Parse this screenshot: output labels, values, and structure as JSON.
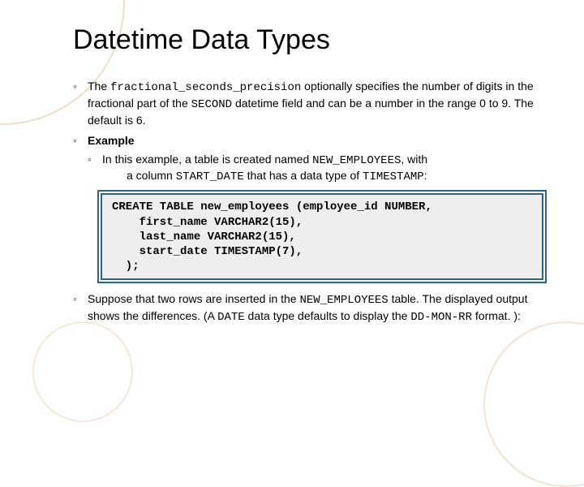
{
  "title": "Datetime Data Types",
  "bullets": {
    "b1_pre": "The ",
    "b1_code1": "fractional_seconds_precision",
    "b1_mid1": " optionally specifies the number of digits in the fractional part of the ",
    "b1_code2": "SECOND",
    "b1_mid2": " datetime field and can be a number in the range 0 to 9. The default is 6.",
    "b2_label": "Example",
    "b2_sub_pre": "In this example, a table is created named ",
    "b2_sub_code1": "NEW_EMPLOYEES",
    "b2_sub_mid1": ", with",
    "b2_sub_line2_pre": "a column ",
    "b2_sub_code2": "START_DATE",
    "b2_sub_mid2": " that has a data type of ",
    "b2_sub_code3": "TIMESTAMP",
    "b2_sub_end": ":",
    "b3_pre": "Suppose that two rows are inserted in the ",
    "b3_code1": "NEW_EMPLOYEES",
    "b3_mid1": " table. The displayed output shows the differences. (A ",
    "b3_code2": "DATE",
    "b3_mid2": " data type defaults to display the ",
    "b3_code3": "DD-MON-RR",
    "b3_end": " format. ):"
  },
  "code": "CREATE TABLE new_employees (employee_id NUMBER,\n    first_name VARCHAR2(15),\n    last_name VARCHAR2(15),\n    start_date TIMESTAMP(7),\n  );"
}
